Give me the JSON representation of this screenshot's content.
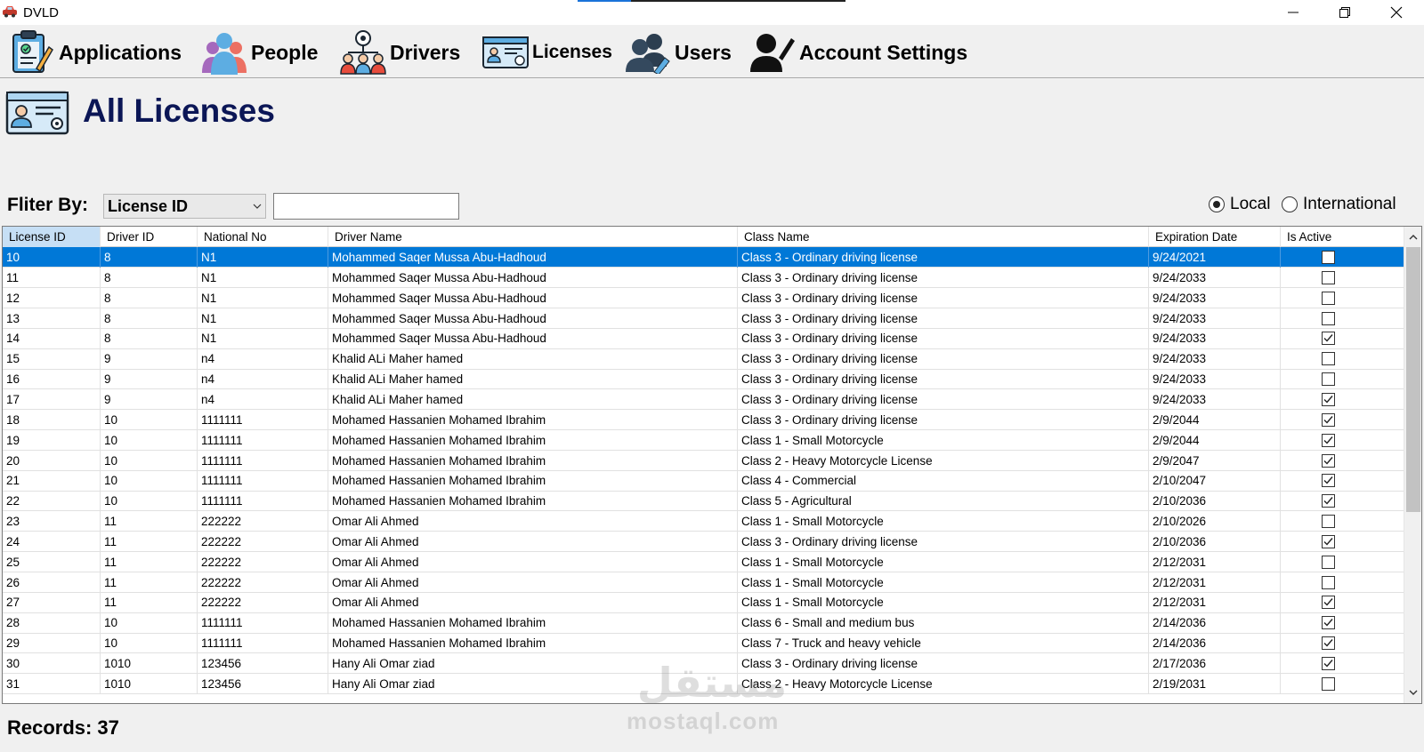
{
  "window": {
    "title": "DVLD",
    "app_icon": "car-icon",
    "loading_progress": 0.2,
    "controls": [
      "minimize-icon",
      "restore-icon",
      "close-icon"
    ]
  },
  "menu": [
    {
      "key": "applications",
      "label": "Applications",
      "icon": "applications-clipboard-icon"
    },
    {
      "key": "people",
      "label": "People",
      "icon": "people-group-icon"
    },
    {
      "key": "drivers",
      "label": "Drivers",
      "icon": "drivers-icon"
    },
    {
      "key": "licenses",
      "label": "Licenses",
      "icon": "license-card-icon"
    },
    {
      "key": "users",
      "label": "Users",
      "icon": "users-edit-icon"
    },
    {
      "key": "account_settings",
      "label": "Account Settings",
      "icon": "account-settings-icon"
    }
  ],
  "page": {
    "title": "All Licenses",
    "icon": "license-card-icon"
  },
  "filter": {
    "label": "Fliter By:",
    "selected": "License ID",
    "value": "",
    "scope_options": [
      {
        "label": "Local",
        "checked": true
      },
      {
        "label": "International",
        "checked": false
      }
    ]
  },
  "grid": {
    "sorted_column": "License ID",
    "columns": [
      "License ID",
      "Driver ID",
      "National No",
      "Driver Name",
      "Class Name",
      "Expiration Date",
      "Is Active"
    ],
    "selected_row": 0,
    "rows": [
      [
        "10",
        "8",
        "N1",
        "Mohammed Saqer Mussa Abu-Hadhoud",
        "Class 3 - Ordinary driving license",
        "9/24/2021",
        false
      ],
      [
        "11",
        "8",
        "N1",
        "Mohammed Saqer Mussa Abu-Hadhoud",
        "Class 3 - Ordinary driving license",
        "9/24/2033",
        false
      ],
      [
        "12",
        "8",
        "N1",
        "Mohammed Saqer Mussa Abu-Hadhoud",
        "Class 3 - Ordinary driving license",
        "9/24/2033",
        false
      ],
      [
        "13",
        "8",
        "N1",
        "Mohammed Saqer Mussa Abu-Hadhoud",
        "Class 3 - Ordinary driving license",
        "9/24/2033",
        false
      ],
      [
        "14",
        "8",
        "N1",
        "Mohammed Saqer Mussa Abu-Hadhoud",
        "Class 3 - Ordinary driving license",
        "9/24/2033",
        true
      ],
      [
        "15",
        "9",
        "n4",
        "Khalid ALi Maher hamed",
        "Class 3 - Ordinary driving license",
        "9/24/2033",
        false
      ],
      [
        "16",
        "9",
        "n4",
        "Khalid ALi Maher hamed",
        "Class 3 - Ordinary driving license",
        "9/24/2033",
        false
      ],
      [
        "17",
        "9",
        "n4",
        "Khalid ALi Maher hamed",
        "Class 3 - Ordinary driving license",
        "9/24/2033",
        true
      ],
      [
        "18",
        "10",
        "1111111",
        "Mohamed Hassanien Mohamed Ibrahim",
        "Class 3 - Ordinary driving license",
        "2/9/2044",
        true
      ],
      [
        "19",
        "10",
        "1111111",
        "Mohamed Hassanien Mohamed Ibrahim",
        "Class 1 - Small Motorcycle",
        "2/9/2044",
        true
      ],
      [
        "20",
        "10",
        "1111111",
        "Mohamed Hassanien Mohamed Ibrahim",
        "Class 2 - Heavy Motorcycle License",
        "2/9/2047",
        true
      ],
      [
        "21",
        "10",
        "1111111",
        "Mohamed Hassanien Mohamed Ibrahim",
        "Class 4 - Commercial",
        "2/10/2047",
        true
      ],
      [
        "22",
        "10",
        "1111111",
        "Mohamed Hassanien Mohamed Ibrahim",
        "Class 5 - Agricultural",
        "2/10/2036",
        true
      ],
      [
        "23",
        "11",
        "222222",
        "Omar Ali  Ahmed",
        "Class 1 - Small Motorcycle",
        "2/10/2026",
        false
      ],
      [
        "24",
        "11",
        "222222",
        "Omar Ali  Ahmed",
        "Class 3 - Ordinary driving license",
        "2/10/2036",
        true
      ],
      [
        "25",
        "11",
        "222222",
        "Omar Ali  Ahmed",
        "Class 1 - Small Motorcycle",
        "2/12/2031",
        false
      ],
      [
        "26",
        "11",
        "222222",
        "Omar Ali  Ahmed",
        "Class 1 - Small Motorcycle",
        "2/12/2031",
        false
      ],
      [
        "27",
        "11",
        "222222",
        "Omar Ali  Ahmed",
        "Class 1 - Small Motorcycle",
        "2/12/2031",
        true
      ],
      [
        "28",
        "10",
        "1111111",
        "Mohamed Hassanien Mohamed Ibrahim",
        "Class 6 - Small and medium bus",
        "2/14/2036",
        true
      ],
      [
        "29",
        "10",
        "1111111",
        "Mohamed Hassanien Mohamed Ibrahim",
        "Class 7 - Truck and heavy vehicle",
        "2/14/2036",
        true
      ],
      [
        "30",
        "1010",
        "123456",
        "Hany Ali Omar ziad",
        "Class 3 - Ordinary driving license",
        "2/17/2036",
        true
      ],
      [
        "31",
        "1010",
        "123456",
        "Hany Ali Omar ziad",
        "Class 2 - Heavy Motorcycle License",
        "2/19/2031",
        false
      ]
    ]
  },
  "footer": {
    "records_label": "Records:",
    "records_count": "37"
  },
  "watermark": {
    "arabic": "مستقل",
    "domain": "mostaql.com"
  },
  "colors": {
    "title": "#0b1656",
    "selection": "#0078d7",
    "sorted_header": "#c6dff5",
    "background": "#f0f0f0"
  }
}
